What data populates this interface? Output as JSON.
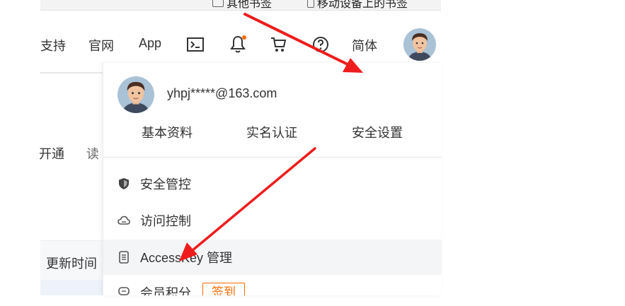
{
  "bookmarks": {
    "other": "其他书签",
    "mobile": "移动设备上的书签"
  },
  "nav": {
    "support": "支持",
    "official_site": "官网",
    "app": "App",
    "language": "简体",
    "icons": [
      "terminal-icon",
      "bell-icon",
      "cart-icon",
      "help-icon"
    ],
    "notification_dot_color": "#ff6a00"
  },
  "background": {
    "tab_open": "开通",
    "tab_read": "读",
    "table_header_updated": "更新时间"
  },
  "account_menu": {
    "email": "yhpj*****@163.com",
    "links": {
      "basic_info": "基本资料",
      "real_name": "实名认证",
      "security_settings": "安全设置"
    },
    "items": [
      {
        "icon": "shield-icon",
        "label": "安全管控"
      },
      {
        "icon": "cloud-icon",
        "label": "访问控制"
      },
      {
        "icon": "key-icon",
        "label": "AccessKey 管理"
      },
      {
        "icon": "coin-icon",
        "label": "会员积分",
        "badge": "签到"
      }
    ],
    "accent_color": "#ff6a00"
  },
  "annotation": {
    "arrow_color": "#ee1c1c"
  }
}
